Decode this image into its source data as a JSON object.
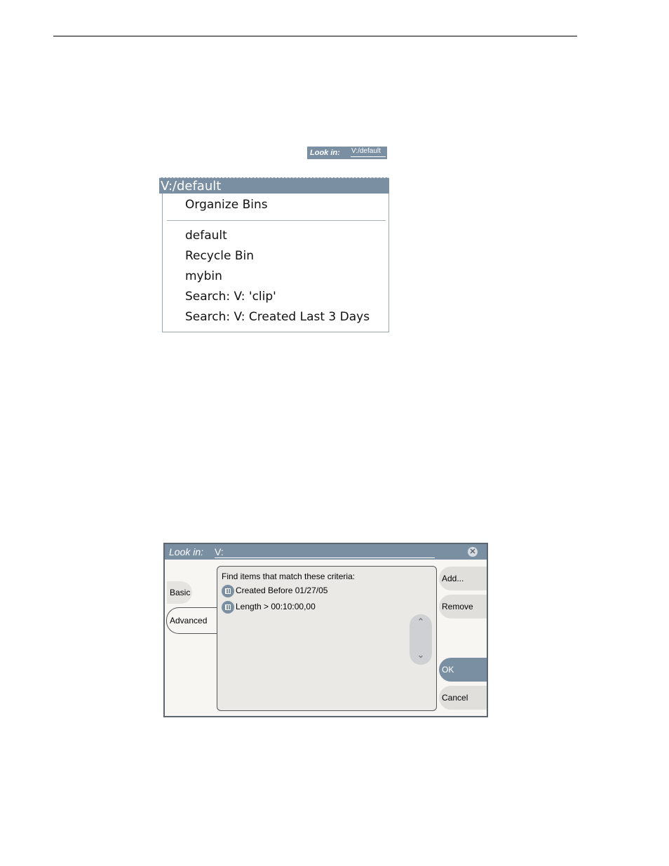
{
  "look_in_mini": {
    "label": "Look in:",
    "value": "V:/default"
  },
  "dropdown": {
    "current": "V:/default",
    "top_item": "Organize Bins",
    "items": [
      "default",
      "Recycle Bin",
      "mybin",
      "Search: V: 'clip'",
      "Search: V: Created Last 3 Days"
    ]
  },
  "dialog": {
    "look_in_label": "Look in:",
    "look_in_value": "V:",
    "close": "✕",
    "tabs": {
      "basic": "Basic",
      "advanced": "Advanced"
    },
    "criteria_heading": "Find items that match these criteria:",
    "criteria": [
      "Created Before 01/27/05",
      "Length > 00:10:00,00"
    ],
    "scroll_up": "⌃",
    "scroll_down": "⌄",
    "buttons": {
      "add": "Add...",
      "remove": "Remove",
      "ok": "OK",
      "cancel": "Cancel"
    }
  },
  "colors": {
    "accent": "#7b8fa3",
    "panel": "#ebe9e6",
    "button": "#e0dfdc"
  }
}
